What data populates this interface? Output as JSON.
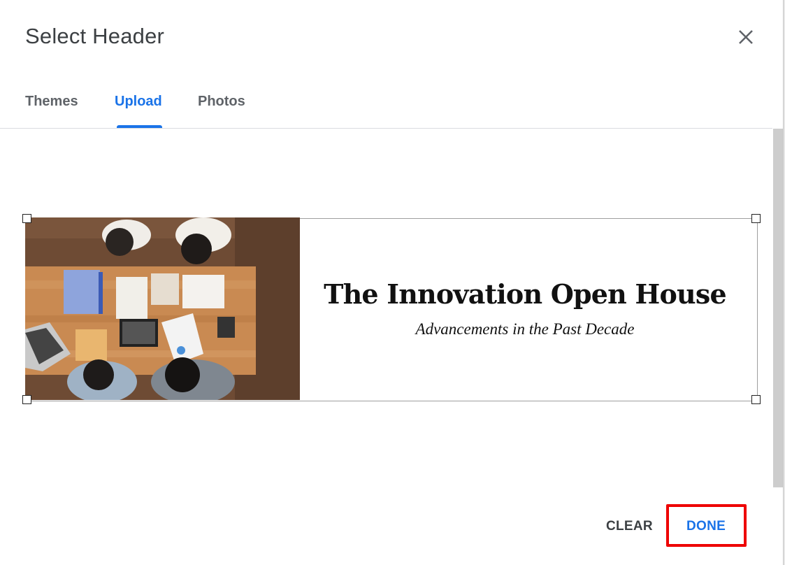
{
  "dialog": {
    "title": "Select Header",
    "close_icon": "close-icon"
  },
  "tabs": [
    {
      "label": "Themes",
      "active": false
    },
    {
      "label": "Upload",
      "active": true
    },
    {
      "label": "Photos",
      "active": false
    }
  ],
  "preview": {
    "image_description": "Overhead photo of four people meeting at a wooden table with laptop, tablets, documents and calculator",
    "banner_title": "The Innovation Open House",
    "banner_subtitle": "Advancements in the Past Decade"
  },
  "actions": {
    "clear_label": "CLEAR",
    "done_label": "DONE"
  },
  "colors": {
    "accent": "#1a73e8",
    "highlight": "#ee0000"
  }
}
